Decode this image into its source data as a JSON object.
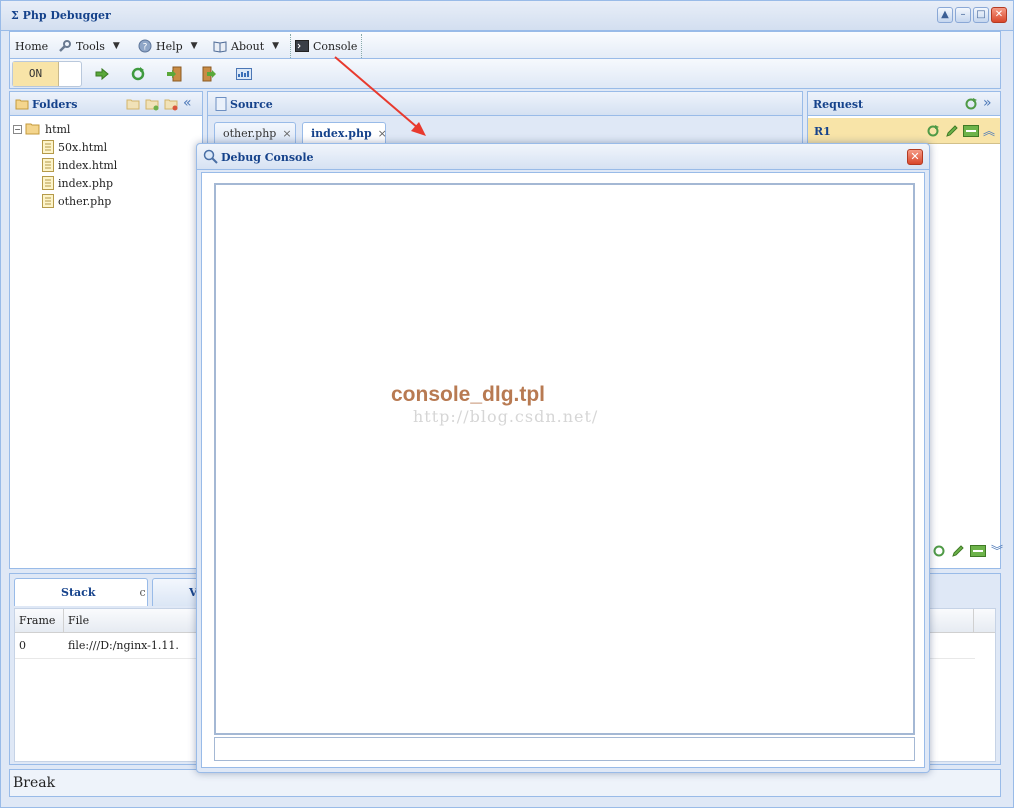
{
  "app": {
    "title": "Σ Php Debugger"
  },
  "menu": {
    "home": "Home",
    "tools": "Tools",
    "help": "Help",
    "about": "About",
    "console": "Console"
  },
  "toolbar": {
    "toggle_label": "ON"
  },
  "folders": {
    "title": "Folders",
    "root": "html",
    "files": [
      "50x.html",
      "index.html",
      "index.php",
      "other.php"
    ]
  },
  "source": {
    "title": "Source",
    "tabs": [
      {
        "label": "other.php",
        "active": false
      },
      {
        "label": "index.php",
        "active": true
      }
    ]
  },
  "request": {
    "title": "Request",
    "item": "R1"
  },
  "bottom": {
    "tabs": [
      "Stack",
      "Va"
    ],
    "stack_refresh_icon": "c",
    "columns": [
      "Frame",
      "File"
    ],
    "rows": [
      {
        "frame": "0",
        "file": "file:///D:/nginx-1.11."
      }
    ]
  },
  "status": {
    "text": "Break"
  },
  "dialog": {
    "title": "Debug Console",
    "watermark_title": "console_dlg.tpl",
    "watermark_url": "http://blog.csdn.net/"
  },
  "colors": {
    "accent": "#15428b",
    "border": "#99bbe8",
    "highlight": "#f8e4a8",
    "arrow": "#e83a2e"
  }
}
